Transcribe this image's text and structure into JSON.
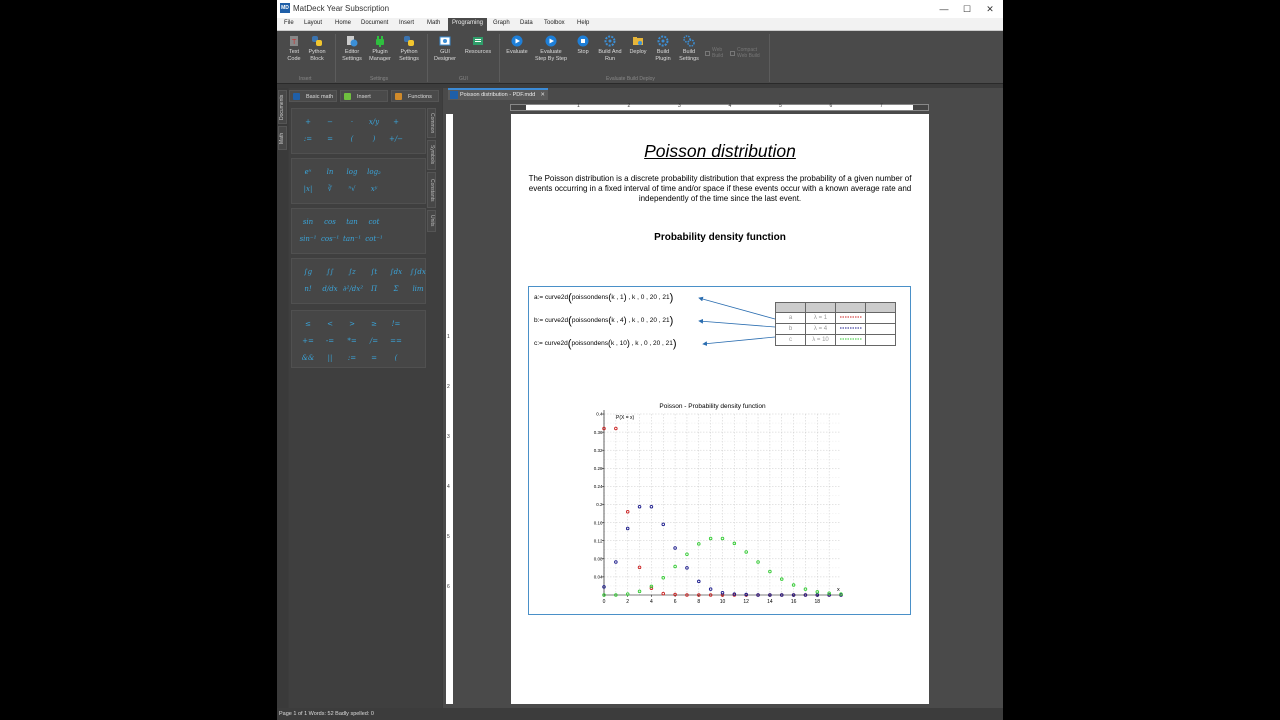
{
  "window": {
    "title": "MatDeck Year Subscription",
    "app_icon": "MD",
    "controls": [
      "—",
      "☐",
      "✕"
    ]
  },
  "menu": {
    "items": [
      "File",
      "Layout",
      "Home",
      "Document",
      "Insert",
      "Math",
      "Programing",
      "Graph",
      "Data",
      "Toolbox",
      "Help"
    ],
    "active": "Programing"
  },
  "ribbon": {
    "buttons": [
      {
        "label": "Text\nCode",
        "icon": "text-code-icon"
      },
      {
        "label": "Python\nBlock",
        "icon": "python-icon"
      },
      {
        "label": "Editor\nSettings",
        "icon": "editor-settings-icon"
      },
      {
        "label": "Plugin\nManager",
        "icon": "plugin-icon"
      },
      {
        "label": "Python\nSettings",
        "icon": "python-icon"
      },
      {
        "label": "GUI\nDesigner",
        "icon": "gui-designer-icon"
      },
      {
        "label": "Resources",
        "icon": "resources-icon"
      },
      {
        "label": "Evaluate",
        "icon": "play-icon"
      },
      {
        "label": "Evaluate\nStep By Step",
        "icon": "play-icon"
      },
      {
        "label": "Stop",
        "icon": "stop-icon"
      },
      {
        "label": "Build And\nRun",
        "icon": "gear-icon"
      },
      {
        "label": "Deploy",
        "icon": "folder-icon"
      },
      {
        "label": "Build\nPlugin",
        "icon": "gear-icon"
      },
      {
        "label": "Build\nSettings",
        "icon": "gears-icon"
      }
    ],
    "groups": [
      "Insert",
      "Settings",
      "GUI",
      "Evaluate Build Deploy"
    ],
    "checks": [
      "Web\nBuild",
      "Compact\nWeb Build"
    ]
  },
  "left_tabs": [
    "Documents",
    "Math"
  ],
  "panel": {
    "tabs": [
      "Basic math",
      "Insert",
      "Functions"
    ],
    "side_tabs": [
      "Common",
      "Symbols",
      "Constants",
      "Units"
    ],
    "groups": [
      [
        "+",
        "−",
        "·",
        "x/y",
        "+",
        ":=",
        "=",
        "(",
        ")",
        "+/−"
      ],
      [
        "eˣ",
        "ln",
        "log",
        "log₂",
        "|x|",
        "∛",
        "ⁿ√",
        "xʸ"
      ],
      [
        "sin",
        "cos",
        "tan",
        "cot",
        "sin⁻¹",
        "cos⁻¹",
        "tan⁻¹",
        "cot⁻¹"
      ],
      [
        "∫g",
        "∫∫",
        "∫z",
        "∫t",
        "∫dx",
        "∫∫dx",
        "n!",
        "d/dx",
        "∂²/dx²",
        "Π",
        "Σ",
        "lim"
      ],
      [
        "≤",
        "<",
        ">",
        "≥",
        "!=",
        "+=",
        "-=",
        "*=",
        "/=",
        "==",
        "&&",
        "||",
        ":=",
        "=",
        "("
      ]
    ]
  },
  "document": {
    "tab_label": "Poisson distribution - PDF.mdd",
    "tab_close": "✕",
    "ruler_top": [
      "1",
      "2",
      "3",
      "4",
      "5",
      "6",
      "7"
    ],
    "ruler_left": [
      "1",
      "2",
      "3",
      "4",
      "5",
      "6"
    ],
    "title": "Poisson distribution",
    "intro": "The Poisson distribution is a discrete probability distribution that express the probability of a given number of events occurring in a fixed interval of time and/or space if these events occur with a known average rate and independently of the time since the last event.",
    "subheading": "Probability density function",
    "expressions": [
      {
        "lhs": "a:= curve2d",
        "fn": "poissondens",
        "arg": "k , 1",
        "rest": "k , 0 , 20 , 21"
      },
      {
        "lhs": "b:= curve2d",
        "fn": "poissondens",
        "arg": "k , 4",
        "rest": "k , 0 , 20 , 21"
      },
      {
        "lhs": "c:= curve2d",
        "fn": "poissondens",
        "arg": "k , 10",
        "rest": "k , 0 , 20 , 21"
      }
    ],
    "legend_rows": [
      {
        "name": "a",
        "lambda": "λ = 1",
        "color": "#cc2222"
      },
      {
        "name": "b",
        "lambda": "λ = 4",
        "color": "#1a1a8c"
      },
      {
        "name": "c",
        "lambda": "λ = 10",
        "color": "#33cc33"
      }
    ]
  },
  "chart_data": {
    "type": "scatter",
    "title": "Poisson - Probability density function",
    "ylabel": "P(X = x)",
    "xlabel": "x",
    "xlim": [
      0,
      20
    ],
    "ylim": [
      0,
      0.4
    ],
    "xticks": [
      0,
      2,
      4,
      6,
      8,
      10,
      12,
      14,
      16,
      18
    ],
    "yticks": [
      0.04,
      0.08,
      0.12,
      0.16,
      0.2,
      0.24,
      0.28,
      0.32,
      0.36,
      0.4
    ],
    "grid": true,
    "series": [
      {
        "name": "a",
        "color": "#cc2222",
        "x": [
          0,
          1,
          2,
          3,
          4,
          5,
          6,
          7,
          8,
          9,
          10,
          11,
          12,
          13,
          14,
          15,
          16,
          17,
          18,
          19,
          20
        ],
        "y": [
          0.368,
          0.368,
          0.184,
          0.061,
          0.015,
          0.003,
          0.001,
          0,
          0,
          0,
          0,
          0,
          0,
          0,
          0,
          0,
          0,
          0,
          0,
          0,
          0
        ]
      },
      {
        "name": "b",
        "color": "#1a1a8c",
        "x": [
          0,
          1,
          2,
          3,
          4,
          5,
          6,
          7,
          8,
          9,
          10,
          11,
          12,
          13,
          14,
          15,
          16,
          17,
          18,
          19,
          20
        ],
        "y": [
          0.018,
          0.073,
          0.147,
          0.195,
          0.195,
          0.156,
          0.104,
          0.06,
          0.03,
          0.013,
          0.005,
          0.002,
          0.001,
          0,
          0,
          0,
          0,
          0,
          0,
          0,
          0
        ]
      },
      {
        "name": "c",
        "color": "#33cc33",
        "x": [
          0,
          1,
          2,
          3,
          4,
          5,
          6,
          7,
          8,
          9,
          10,
          11,
          12,
          13,
          14,
          15,
          16,
          17,
          18,
          19,
          20
        ],
        "y": [
          0,
          0,
          0.002,
          0.008,
          0.019,
          0.038,
          0.063,
          0.09,
          0.113,
          0.125,
          0.125,
          0.114,
          0.095,
          0.073,
          0.052,
          0.035,
          0.022,
          0.013,
          0.007,
          0.004,
          0.002
        ]
      }
    ]
  },
  "status": "Page 1 of 1   Words: 52   Badly spelled: 0"
}
